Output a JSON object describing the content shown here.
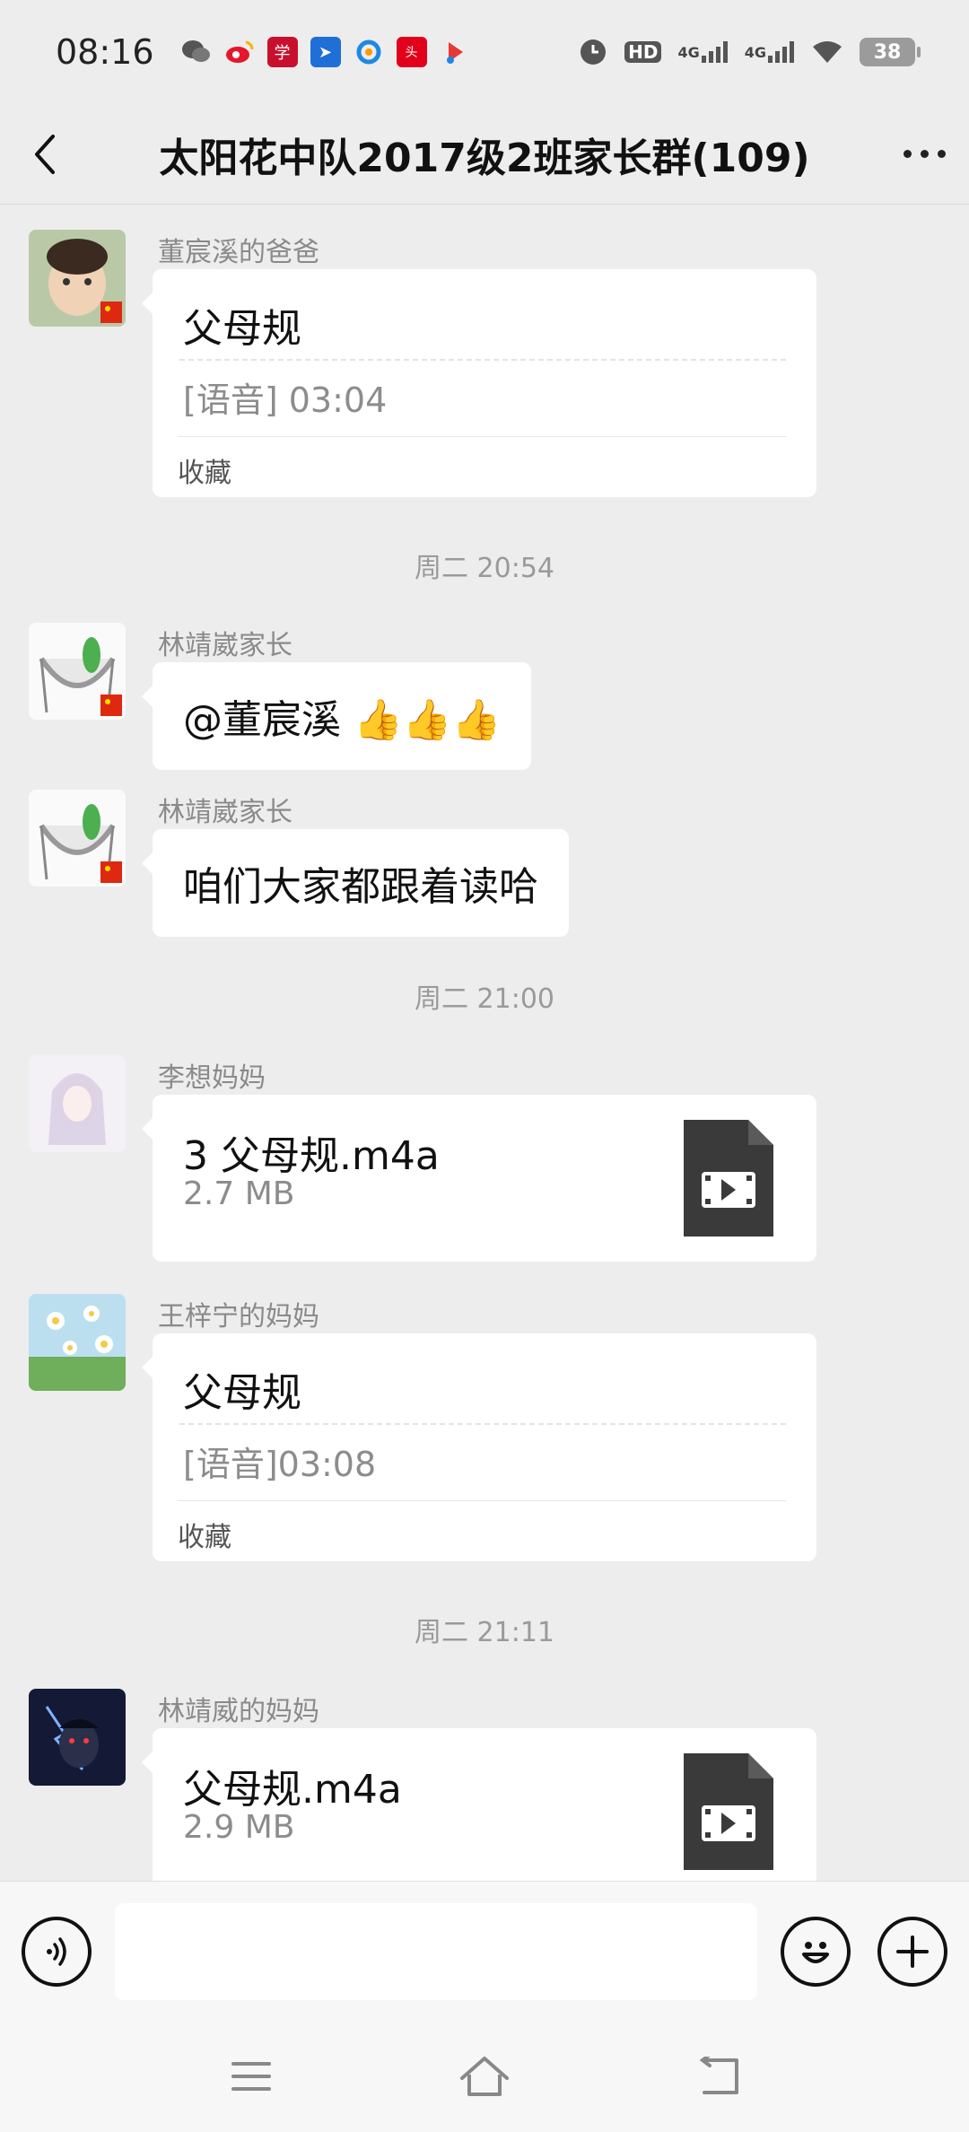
{
  "status_bar": {
    "time": "08:16",
    "battery": "38",
    "notification_icons": [
      "wechat-icon",
      "weibo-icon",
      "xuexi-icon",
      "app-icon",
      "browser-icon",
      "news-icon",
      "video-icon"
    ],
    "right_icons": [
      "alarm-icon",
      "hd-icon",
      "4g-signal-icon",
      "4g-signal-icon",
      "wifi-icon"
    ],
    "hd_label": "HD",
    "net1": "4G",
    "net2": "4G"
  },
  "header": {
    "title": "太阳花中队2017级2班家长群(109)"
  },
  "messages": [
    {
      "sender": "董宸溪的爸爸",
      "type": "card",
      "title": "父母规",
      "subtitle": "[语音] 03:04",
      "footer": "收藏"
    },
    {
      "type": "time",
      "text": "周二 20:54"
    },
    {
      "sender": "林靖崴家长",
      "type": "text",
      "text": "@董宸溪 👍👍👍"
    },
    {
      "sender": "林靖崴家长",
      "type": "text",
      "text": "咱们大家都跟着读哈"
    },
    {
      "type": "time",
      "text": "周二 21:00"
    },
    {
      "sender": "李想妈妈",
      "type": "file",
      "name": "3 父母规.m4a",
      "size": "2.7 MB"
    },
    {
      "sender": "王梓宁的妈妈",
      "type": "card",
      "title": "父母规",
      "subtitle": "[语音]03:08",
      "footer": "收藏"
    },
    {
      "type": "time",
      "text": "周二 21:11"
    },
    {
      "sender": "林靖威的妈妈",
      "type": "file",
      "name": "父母规.m4a",
      "size": "2.9 MB"
    }
  ],
  "input": {
    "value": "",
    "placeholder": ""
  },
  "colors": {
    "background": "#ededed",
    "bubble": "#ffffff",
    "file_icon": "#3a3a3a",
    "secondary_text": "#8a8a8a"
  }
}
